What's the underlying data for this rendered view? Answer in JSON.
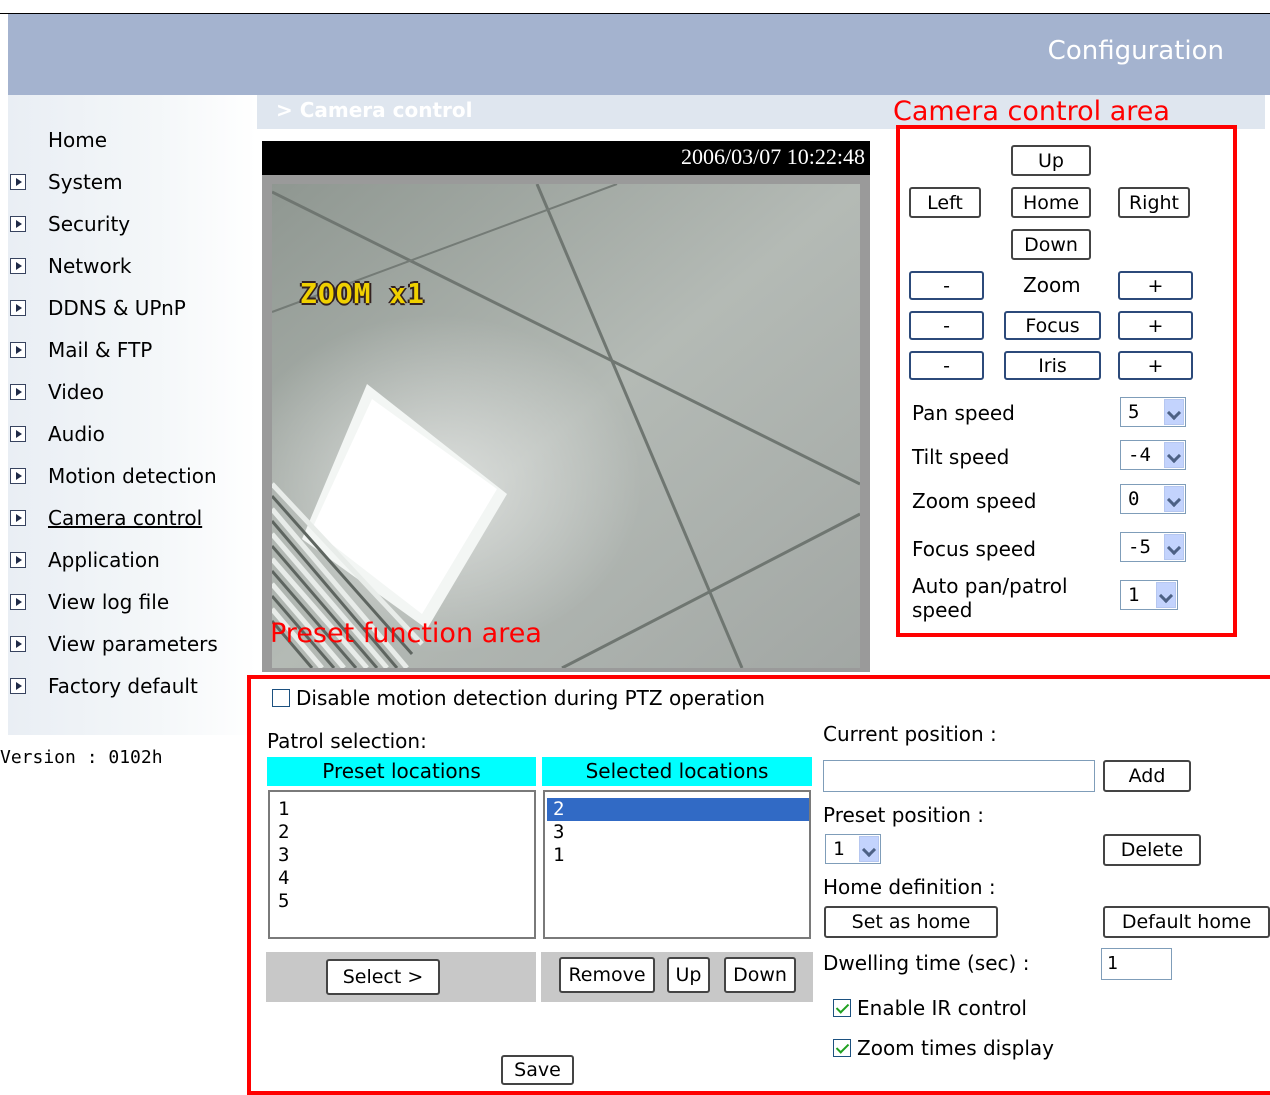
{
  "header": {
    "title": "Configuration"
  },
  "sidebar": {
    "items": [
      {
        "label": "Home",
        "arrow": false
      },
      {
        "label": "System",
        "arrow": true
      },
      {
        "label": "Security",
        "arrow": true
      },
      {
        "label": "Network",
        "arrow": true
      },
      {
        "label": "DDNS & UPnP",
        "arrow": true
      },
      {
        "label": "Mail & FTP",
        "arrow": true
      },
      {
        "label": "Video",
        "arrow": true
      },
      {
        "label": "Audio",
        "arrow": true
      },
      {
        "label": "Motion detection",
        "arrow": true
      },
      {
        "label": "Camera control",
        "arrow": true,
        "current": true
      },
      {
        "label": "Application",
        "arrow": true
      },
      {
        "label": "View log file",
        "arrow": true
      },
      {
        "label": "View parameters",
        "arrow": true
      },
      {
        "label": "Factory default",
        "arrow": true
      }
    ],
    "version": "Version : 0102h"
  },
  "breadcrumb": "> Camera control",
  "video": {
    "timestamp": "2006/03/07 10:22:48",
    "overlay": "ZOOM x1"
  },
  "annotations": {
    "camera_area": "Camera control area",
    "preset_area": "Preset function area"
  },
  "camera": {
    "up": "Up",
    "left": "Left",
    "home": "Home",
    "right": "Right",
    "down": "Down",
    "minus": "-",
    "plus": "+",
    "zoom": "Zoom",
    "focus": "Focus",
    "iris": "Iris",
    "pan_speed_label": "Pan speed",
    "pan_speed": "5",
    "tilt_speed_label": "Tilt speed",
    "tilt_speed": "-4",
    "zoom_speed_label": "Zoom speed",
    "zoom_speed": "0",
    "focus_speed_label": "Focus speed",
    "focus_speed": "-5",
    "auto_speed_label_1": "Auto pan/patrol",
    "auto_speed_label_2": "speed",
    "auto_speed": "1"
  },
  "preset": {
    "disable_md": "Disable motion detection during PTZ operation",
    "disable_md_checked": false,
    "patrol_selection": "Patrol selection:",
    "preset_locations_header": "Preset locations",
    "selected_locations_header": "Selected locations",
    "preset_locations": [
      "1",
      "2",
      "3",
      "4",
      "5"
    ],
    "selected_locations": [
      "2",
      "3",
      "1"
    ],
    "selected_highlight": "2",
    "select_btn": "Select >",
    "remove_btn": "Remove",
    "up_btn": "Up",
    "down_btn": "Down",
    "current_position_label": "Current position :",
    "current_position_value": "",
    "add_btn": "Add",
    "preset_position_label": "Preset position :",
    "preset_position": "1",
    "delete_btn": "Delete",
    "home_definition_label": "Home definition :",
    "set_home_btn": "Set as home",
    "default_home_btn": "Default home",
    "dwelling_label": "Dwelling time (sec) :",
    "dwelling_value": "1",
    "enable_ir": "Enable IR control",
    "enable_ir_checked": true,
    "zoom_display": "Zoom times display",
    "zoom_display_checked": true,
    "save_btn": "Save"
  }
}
